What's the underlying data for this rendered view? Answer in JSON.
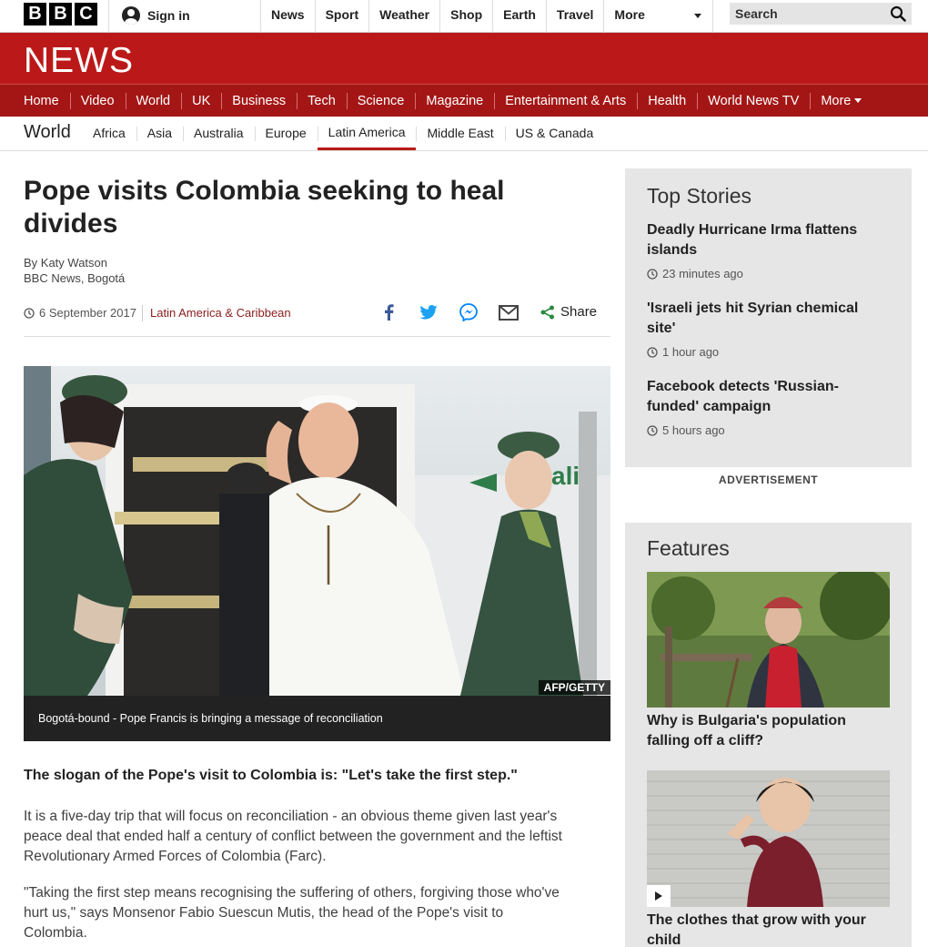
{
  "topbar": {
    "logo_letters": [
      "B",
      "B",
      "C"
    ],
    "signin_label": "Sign in",
    "nav": [
      "News",
      "Sport",
      "Weather",
      "Shop",
      "Earth",
      "Travel",
      "More"
    ],
    "search_placeholder": "Search"
  },
  "masthead": {
    "title": "NEWS"
  },
  "main_nav": {
    "items": [
      "Home",
      "Video",
      "World",
      "UK",
      "Business",
      "Tech",
      "Science",
      "Magazine",
      "Entertainment & Arts",
      "Health",
      "World News TV",
      "More"
    ],
    "active": "World"
  },
  "section_nav": {
    "section": "World",
    "items": [
      "Africa",
      "Asia",
      "Australia",
      "Europe",
      "Latin America",
      "Middle East",
      "US & Canada"
    ],
    "active": "Latin America"
  },
  "article": {
    "headline": "Pope visits Colombia seeking to heal divides",
    "author": "By Katy Watson",
    "location": "BBC News, Bogotá",
    "date": "6 September 2017",
    "topic": "Latin America & Caribbean",
    "share_label": "Share",
    "image_credit": "AFP/GETTY",
    "caption": "Bogotá-bound - Pope Francis is bringing a message of reconciliation",
    "lede": "The slogan of the Pope's visit to Colombia is: \"Let's take the first step.\"",
    "paragraphs": [
      "It is a five-day trip that will focus on reconciliation - an obvious theme given last year's peace deal that ended half a century of conflict between the government and the leftist Revolutionary Armed Forces of Colombia (Farc).",
      "\"Taking the first step means recognising the suffering of others, forgiving those who've hurt us,\" says Monsenor Fabio Suescun Mutis, the head of the Pope's visit to Colombia."
    ]
  },
  "top_stories": {
    "heading": "Top Stories",
    "items": [
      {
        "title": "Deadly Hurricane Irma flattens islands",
        "time": "23 minutes ago"
      },
      {
        "title": "'Israeli jets hit Syrian chemical site'",
        "time": "1 hour ago"
      },
      {
        "title": "Facebook detects 'Russian-funded' campaign",
        "time": "5 hours ago"
      }
    ]
  },
  "advertisement_label": "ADVERTISEMENT",
  "features": {
    "heading": "Features",
    "items": [
      {
        "title": "Why is Bulgaria's population falling off a cliff?"
      },
      {
        "title": "The clothes that grow with your child"
      }
    ]
  },
  "colors": {
    "brand_red": "#bb1919",
    "nav_red": "#a41616",
    "panel_grey": "#e6e6e6"
  }
}
